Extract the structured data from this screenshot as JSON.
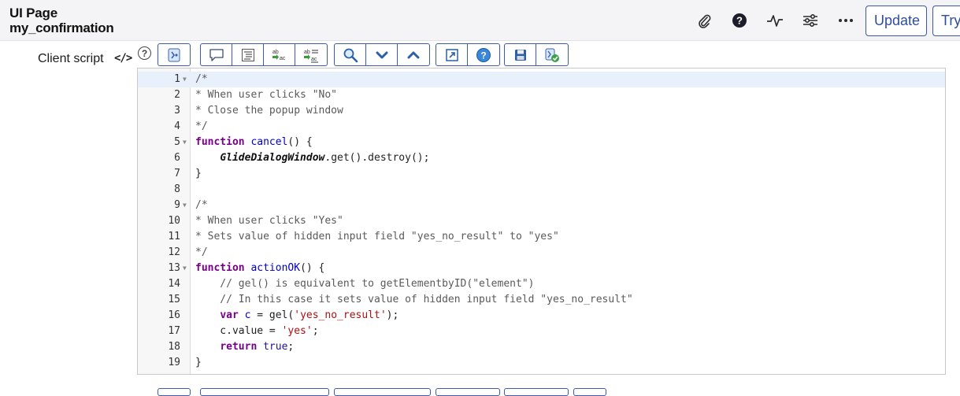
{
  "header": {
    "title": "UI Page",
    "record_name": "my_confirmation",
    "icons": [
      "paperclip-icon",
      "help-icon",
      "activity-icon",
      "settings-sliders-icon",
      "more-icon"
    ],
    "update_label": "Update",
    "try_label": "Try"
  },
  "field": {
    "label": "Client script",
    "code_glyph": "</>",
    "help_glyph": "?"
  },
  "toolbar": {
    "groups": [
      [
        "script-tree-icon"
      ],
      [
        "comment-icon",
        "format-icon",
        "replace-icon",
        "replace-all-icon"
      ],
      [
        "search-icon",
        "chevron-down-icon",
        "chevron-up-icon"
      ],
      [
        "fullscreen-icon",
        "help-icon"
      ],
      [
        "save-icon",
        "syntax-check-icon"
      ]
    ]
  },
  "editor": {
    "lines": [
      {
        "n": "1",
        "fold": true,
        "text": "/*"
      },
      {
        "n": "2",
        "fold": false,
        "text": "* When user clicks \"No\""
      },
      {
        "n": "3",
        "fold": false,
        "text": "* Close the popup window"
      },
      {
        "n": "4",
        "fold": false,
        "text": "*/"
      },
      {
        "n": "5",
        "fold": true,
        "text": "function cancel() {"
      },
      {
        "n": "6",
        "fold": false,
        "text": "    GlideDialogWindow.get().destroy();"
      },
      {
        "n": "7",
        "fold": false,
        "text": "}"
      },
      {
        "n": "8",
        "fold": false,
        "text": ""
      },
      {
        "n": "9",
        "fold": true,
        "text": "/*"
      },
      {
        "n": "10",
        "fold": false,
        "text": "* When user clicks \"Yes\""
      },
      {
        "n": "11",
        "fold": false,
        "text": "* Sets value of hidden input field \"yes_no_result\" to \"yes\""
      },
      {
        "n": "12",
        "fold": false,
        "text": "*/"
      },
      {
        "n": "13",
        "fold": true,
        "text": "function actionOK() {"
      },
      {
        "n": "14",
        "fold": false,
        "text": "    // gel() is equivalent to getElementbyID(\"element\")"
      },
      {
        "n": "15",
        "fold": false,
        "text": "    // In this case it sets value of hidden input field \"yes_no_result\""
      },
      {
        "n": "16",
        "fold": false,
        "text": "    var c = gel('yes_no_result');"
      },
      {
        "n": "17",
        "fold": false,
        "text": "    c.value = 'yes';"
      },
      {
        "n": "18",
        "fold": false,
        "text": "    return true;"
      },
      {
        "n": "19",
        "fold": false,
        "text": "}"
      }
    ]
  }
}
